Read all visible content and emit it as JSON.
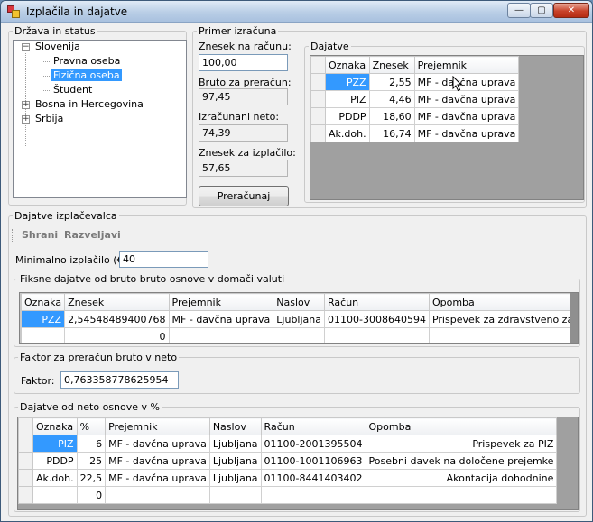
{
  "window": {
    "title": "Izplačila in dajatve",
    "min": "—",
    "max": "▢",
    "close": "✕"
  },
  "country_group": {
    "legend": "Država in status",
    "tree": [
      {
        "label": "Slovenija",
        "expander": "−"
      },
      {
        "label": "Pravna oseba"
      },
      {
        "label": "Fizična oseba"
      },
      {
        "label": "Študent"
      },
      {
        "label": "Bosna in Hercegovina",
        "expander": "+"
      },
      {
        "label": "Srbija",
        "expander": "+"
      }
    ]
  },
  "example_group": {
    "legend": "Primer izračuna",
    "invoice_label": "Znesek na računu:",
    "invoice_value": "100,00",
    "gross_label": "Bruto za preračun:",
    "gross_value": "97,45",
    "net_label": "Izračunani neto:",
    "net_value": "74,39",
    "payout_label": "Znesek za izplačilo:",
    "payout_value": "57,65",
    "calc_button": "Preračunaj"
  },
  "taxes_group": {
    "legend": "Dajatve",
    "columns": [
      "Oznaka",
      "Znesek",
      "Prejemnik"
    ],
    "rows": [
      [
        "PZZ",
        "2,55",
        "MF - davčna uprava"
      ],
      [
        "PIZ",
        "4,46",
        "MF - davčna uprava"
      ],
      [
        "PDDP",
        "18,60",
        "MF - davčna uprava"
      ],
      [
        "Ak.doh.",
        "16,74",
        "MF - davčna uprava"
      ]
    ]
  },
  "payer_group": {
    "legend": "Dajatve izplačevalca",
    "save": "Shrani",
    "undo": "Razveljavi",
    "min_label": "Minimalno izplačilo (€):",
    "min_value": "40"
  },
  "fixed_group": {
    "legend": "Fiksne dajatve od bruto bruto osnove v domači valuti",
    "columns": [
      "Oznaka",
      "Znesek",
      "Prejemnik",
      "Naslov",
      "Račun",
      "Opomba"
    ],
    "rows": [
      [
        "PZZ",
        "2,54548489400768",
        "MF - davčna uprava",
        "Ljubljana",
        "01100-3008640594",
        "Prispevek za zdravstveno zavarovanje"
      ],
      [
        "",
        "0",
        "",
        "",
        "",
        ""
      ]
    ]
  },
  "factor_group": {
    "legend": "Faktor za preračun bruto v neto",
    "label": "Faktor:",
    "value": "0,763358778625954"
  },
  "percent_group": {
    "legend": "Dajatve od neto osnove v %",
    "columns": [
      "Oznaka",
      "%",
      "Prejemnik",
      "Naslov",
      "Račun",
      "Opomba"
    ],
    "rows": [
      [
        "PIZ",
        "6",
        "MF - davčna uprava",
        "Ljubljana",
        "01100-2001395504",
        "Prispevek za PIZ"
      ],
      [
        "PDDP",
        "25",
        "MF - davčna uprava",
        "Ljubljana",
        "01100-1001106963",
        "Posebni davek na določene prejemke"
      ],
      [
        "Ak.doh.",
        "22,5",
        "MF - davčna uprava",
        "Ljubljana",
        "01100-8441403402",
        "Akontacija dohodnine"
      ],
      [
        "",
        "0",
        "",
        "",
        "",
        ""
      ]
    ]
  }
}
